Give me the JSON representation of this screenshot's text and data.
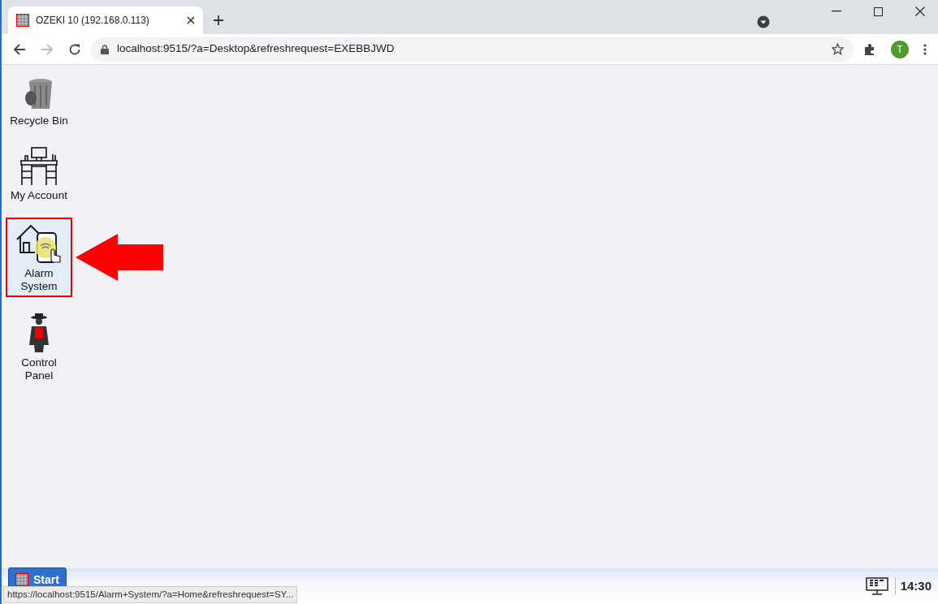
{
  "browser": {
    "tab_title": "OZEKI 10 (192.168.0.113)",
    "address": "localhost:9515/?a=Desktop&refreshrequest=EXEBBJWD",
    "profile_initial": "T"
  },
  "desktop_icons": [
    {
      "label": "Recycle Bin",
      "kind": "bin",
      "selected": false
    },
    {
      "label": "My Account",
      "kind": "desk",
      "selected": false
    },
    {
      "label": "Alarm System",
      "kind": "alarm",
      "selected": true
    },
    {
      "label": "Control Panel",
      "kind": "agent",
      "selected": false
    }
  ],
  "taskbar": {
    "start_label": "Start",
    "clock": "14:30"
  },
  "status_link": "https://localhost:9515/Alarm+System/?a=Home&refreshrequest=SY..."
}
